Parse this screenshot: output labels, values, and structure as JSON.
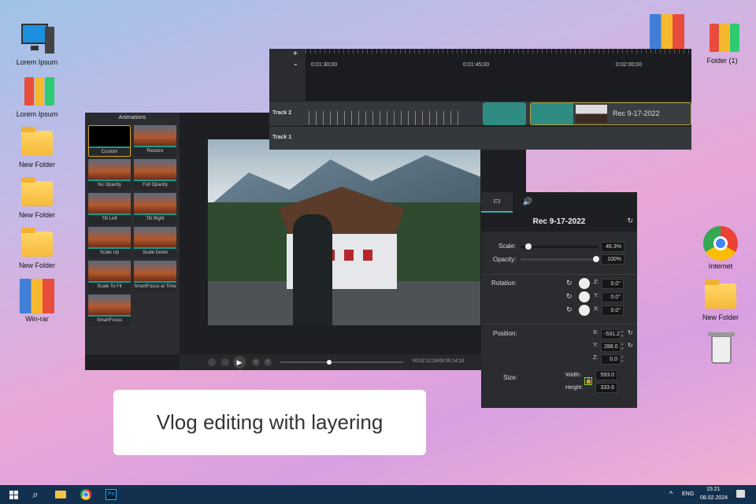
{
  "desktop": {
    "left_icons": [
      "Lorem Ipsum",
      "Lorem Ipsum",
      "New Folder",
      "New Folder",
      "New Folder",
      "Win-rar"
    ],
    "right_icons": [
      "Folder (1)",
      "Internet",
      "New Folder"
    ]
  },
  "animations": {
    "title": "Animations",
    "items": [
      "Custom",
      "Restore",
      "No Opacity",
      "Full Opacity",
      "Tilt Left",
      "Tilt Right",
      "Scale Up",
      "Scale Down",
      "Scale To Fit",
      "SmartFocus at Time",
      "SmartFocus"
    ]
  },
  "player": {
    "timecode": "00:02:12;18/00:05:14;18",
    "progress": 0.4
  },
  "timeline": {
    "ticks": [
      "0:01:30;00",
      "0:01:45;00",
      "0:02:00;00"
    ],
    "tracks": [
      "Track 2",
      "Track 1"
    ],
    "clip_label": "Rec 9-17-2022"
  },
  "properties": {
    "title": "Rec 9-17-2022",
    "scale_label": "Scale:",
    "scale": "46.3%",
    "scale_fraction": 0.1,
    "opacity_label": "Opacity:",
    "opacity": "100%",
    "rotation_label": "Rotation:",
    "rot": [
      {
        "axis": "Z:",
        "value": "0.0°"
      },
      {
        "axis": "Y:",
        "value": "0.0°"
      },
      {
        "axis": "X:",
        "value": "0.0°"
      }
    ],
    "position_label": "Position:",
    "pos": [
      {
        "axis": "X:",
        "value": "-531.2"
      },
      {
        "axis": "Y:",
        "value": "288.0"
      },
      {
        "axis": "Z:",
        "value": "0.0"
      }
    ],
    "size_label": "Size:",
    "width_label": "Width:",
    "width": "593.0",
    "height_label": "Height:",
    "height": "333.6"
  },
  "caption": "Vlog editing with layering",
  "taskbar": {
    "lang": "ENG",
    "time": "15:21",
    "date": "08.02.2024",
    "ps": "Ps"
  }
}
